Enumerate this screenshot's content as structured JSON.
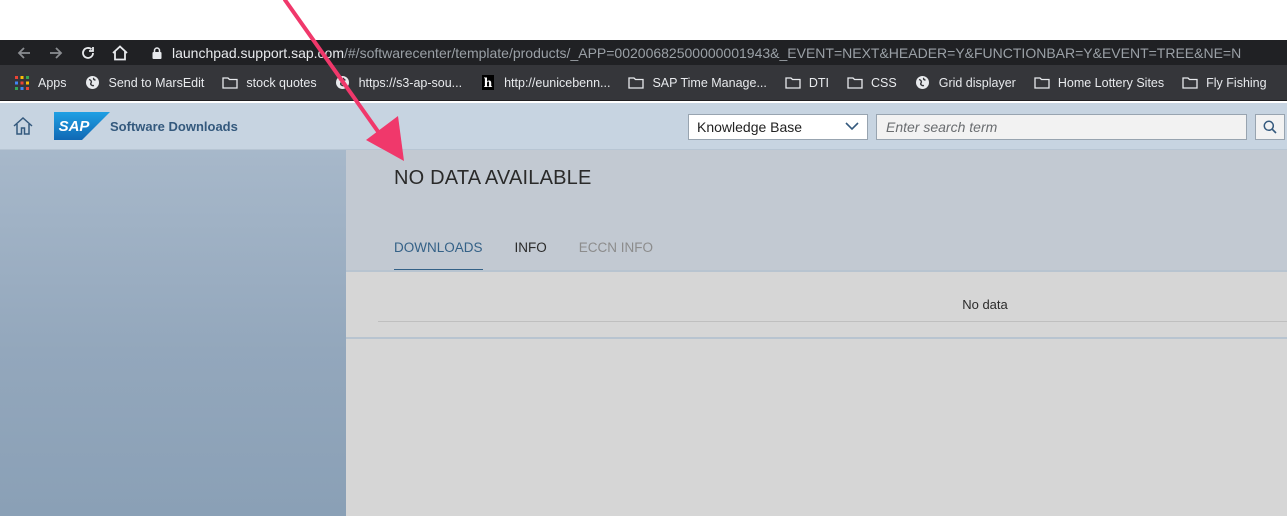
{
  "browser": {
    "url_host": "launchpad.support.sap.com",
    "url_path": "/#/softwarecenter/template/products/_APP=00200682500000001943&_EVENT=NEXT&HEADER=Y&FUNCTIONBAR=Y&EVENT=TREE&NE=N"
  },
  "bookmarks": [
    {
      "label": "Apps",
      "icon": "apps-grid-icon"
    },
    {
      "label": "Send to MarsEdit",
      "icon": "globe-icon"
    },
    {
      "label": "stock quotes",
      "icon": "folder-icon"
    },
    {
      "label": "https://s3-ap-sou...",
      "icon": "globe-icon"
    },
    {
      "label": "http://eunicebenn...",
      "icon": "h-site-icon"
    },
    {
      "label": "SAP Time Manage...",
      "icon": "folder-icon"
    },
    {
      "label": "DTI",
      "icon": "folder-icon"
    },
    {
      "label": "CSS",
      "icon": "folder-icon"
    },
    {
      "label": "Grid displayer",
      "icon": "globe-icon"
    },
    {
      "label": "Home Lottery Sites",
      "icon": "folder-icon"
    },
    {
      "label": "Fly Fishing",
      "icon": "folder-icon"
    }
  ],
  "shell": {
    "logo_text": "SAP",
    "title": "Software Downloads",
    "search_scope": "Knowledge Base",
    "search_placeholder": "Enter search term"
  },
  "content": {
    "title": "NO DATA AVAILABLE",
    "tabs": [
      {
        "label": "DOWNLOADS",
        "state": "active"
      },
      {
        "label": "INFO",
        "state": "normal"
      },
      {
        "label": "ECCN INFO",
        "state": "disabled"
      }
    ],
    "empty_text": "No data"
  },
  "colors": {
    "accent": "#346187",
    "annotation_arrow": "#f0386b",
    "shell_bg": "#c7d4e1"
  }
}
